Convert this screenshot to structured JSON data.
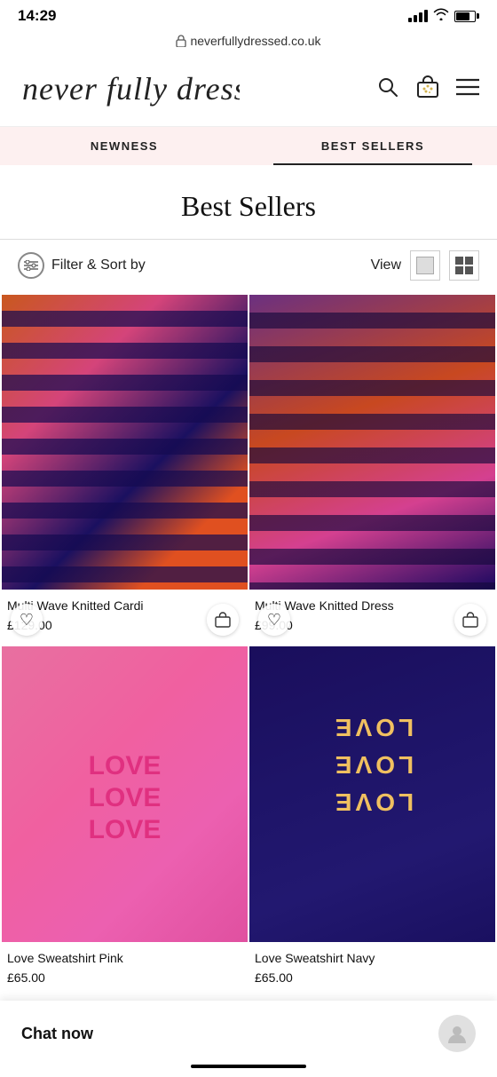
{
  "statusBar": {
    "time": "14:29",
    "url": "neverfullydressed.co.uk"
  },
  "header": {
    "logo": "never fully dressed",
    "searchIcon": "search",
    "bagIcon": "bag",
    "menuIcon": "menu"
  },
  "nav": {
    "tabs": [
      {
        "id": "newness",
        "label": "NEWNESS",
        "active": false
      },
      {
        "id": "bestsellers",
        "label": "BEST SELLERS",
        "active": true
      }
    ]
  },
  "pageTitle": "Best Sellers",
  "filterBar": {
    "filterLabel": "Filter & Sort by",
    "viewLabel": "View"
  },
  "products": [
    {
      "id": 1,
      "name": "Multi Wave Knitted Cardi",
      "price": "£129.00",
      "imgClass": "product-img-1"
    },
    {
      "id": 2,
      "name": "Multi Wave Knitted Dress",
      "price": "£99.00",
      "imgClass": "product-img-2"
    },
    {
      "id": 3,
      "name": "Love Sweatshirt Pink",
      "price": "£65.00",
      "imgClass": "product-img-3"
    },
    {
      "id": 4,
      "name": "Love Sweatshirt Navy",
      "price": "£65.00",
      "imgClass": "product-img-4"
    }
  ],
  "chat": {
    "label": "Chat now"
  }
}
